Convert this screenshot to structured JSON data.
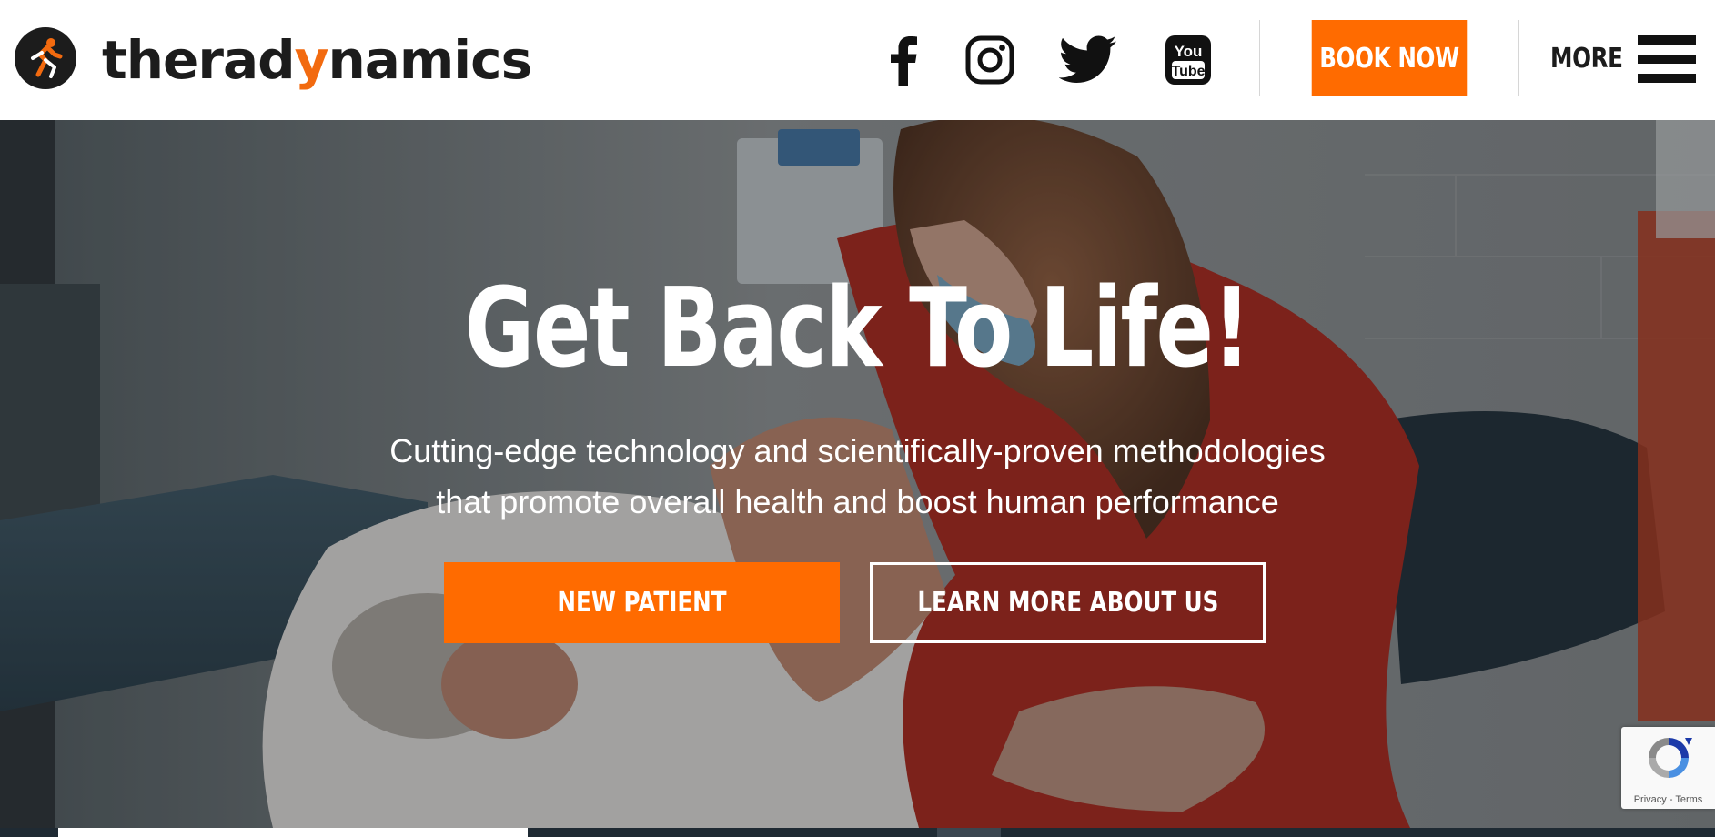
{
  "brand": {
    "name_prefix": "therad",
    "name_accent": "y",
    "name_suffix": "namics",
    "accent_color": "#f26a0f"
  },
  "header": {
    "social": [
      {
        "name": "facebook",
        "icon": "facebook-icon"
      },
      {
        "name": "instagram",
        "icon": "instagram-icon"
      },
      {
        "name": "twitter",
        "icon": "twitter-icon"
      },
      {
        "name": "youtube",
        "icon": "youtube-icon",
        "line1": "You",
        "line2": "Tube"
      }
    ],
    "book_label": "BOOK NOW",
    "more_label": "MORE",
    "menu_icon": "hamburger-menu-icon",
    "cta_color": "#ff6b00"
  },
  "hero": {
    "title": "Get Back To Life!",
    "subtitle_line1": "Cutting-edge technology and scientifically-proven methodologies",
    "subtitle_line2": "that promote overall health and boost human performance",
    "primary_cta": "NEW PATIENT",
    "secondary_cta": "LEARN MORE ABOUT US"
  },
  "recaptcha": {
    "privacy": "Privacy",
    "separator": " - ",
    "terms": "Terms"
  }
}
